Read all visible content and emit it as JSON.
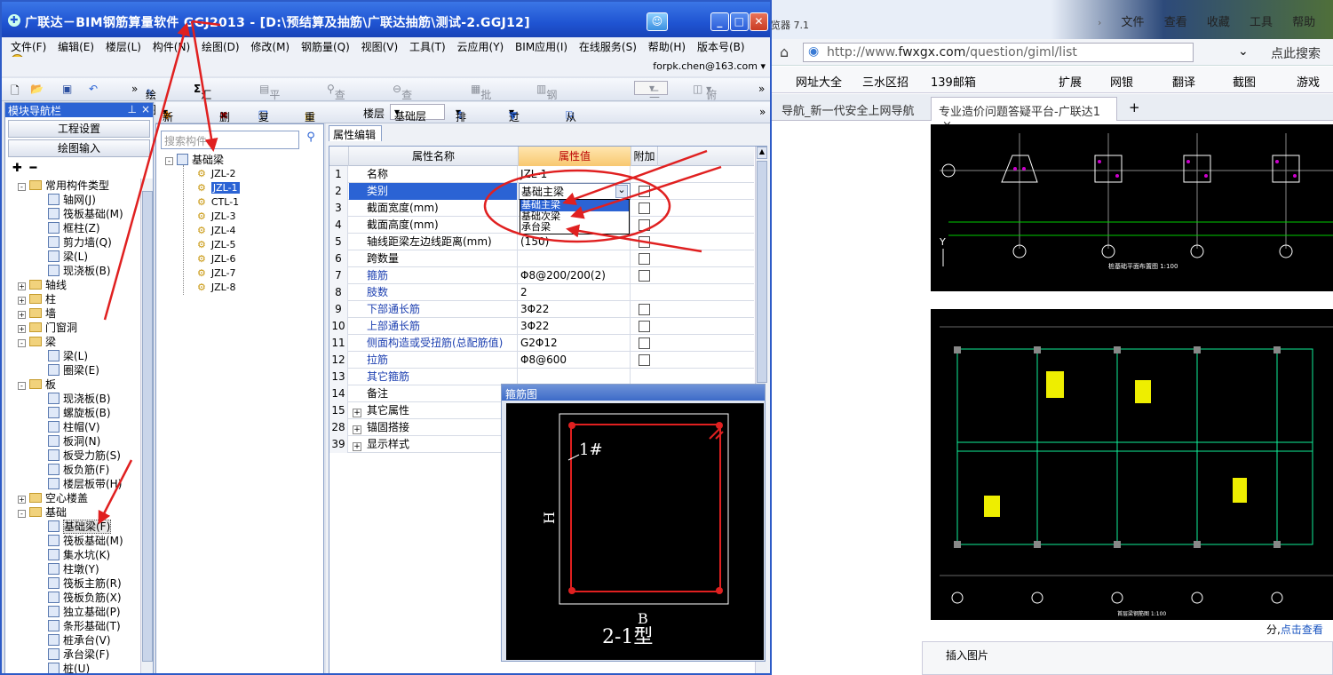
{
  "browser": {
    "title_partial": "览器 7.1",
    "menu": [
      "文件",
      "查看",
      "收藏",
      "工具",
      "帮助"
    ],
    "url_prefix": "http://www.",
    "url_domain": "fwxgx.com",
    "url_path": "/question/giml/list",
    "search_placeholder": "点此搜索",
    "favorites": [
      "网址大全",
      "三水区招",
      "139邮箱",
      "扩展",
      "网银",
      "翻译",
      "截图",
      "游戏"
    ],
    "tabs": [
      "导航_新一代安全上网导航",
      "专业造价问题答疑平台-广联达1"
    ],
    "cad1_caption": "桩基础平面布置图 1:100",
    "cad2_caption": "首层梁钢筋图 1:100",
    "footer_text": "分,",
    "footer_link": "点击查看",
    "insert_image": "插入图片"
  },
  "app": {
    "title": "广联达－BIM钢筋算量软件 GGJ2013 - [D:\\预结算及抽筋\\广联达抽筋\\测试-2.GGJ12]",
    "menu": [
      "文件(F)",
      "编辑(E)",
      "楼层(L)",
      "构件(N)",
      "绘图(D)",
      "修改(M)",
      "钢筋量(Q)",
      "视图(V)",
      "工具(T)",
      "云应用(Y)",
      "BIM应用(I)",
      "在线服务(S)",
      "帮助(H)",
      "版本号(B)"
    ],
    "account": "forpk.chen@163.com ▾",
    "toolbar1": {
      "draw": "绘图",
      "sum": "汇总计算",
      "flat": "平齐板顶",
      "find": "查找图元",
      "view_rebar": "查看钢筋量",
      "batch": "批量选择",
      "rebar3d": "钢筋三维",
      "mode": "二维",
      "view": "俯视"
    },
    "nav": {
      "header": "模块导航栏",
      "project_settings": "工程设置",
      "drawing_input": "绘图输入"
    },
    "nav_tree": [
      {
        "label": "常用构件类型",
        "level": 0,
        "type": "folder",
        "exp": "-"
      },
      {
        "label": "轴网(J)",
        "level": 1,
        "type": "item"
      },
      {
        "label": "筏板基础(M)",
        "level": 1,
        "type": "item"
      },
      {
        "label": "框柱(Z)",
        "level": 1,
        "type": "item"
      },
      {
        "label": "剪力墙(Q)",
        "level": 1,
        "type": "item"
      },
      {
        "label": "梁(L)",
        "level": 1,
        "type": "item"
      },
      {
        "label": "现浇板(B)",
        "level": 1,
        "type": "item"
      },
      {
        "label": "轴线",
        "level": 0,
        "type": "folder",
        "exp": "+"
      },
      {
        "label": "柱",
        "level": 0,
        "type": "folder",
        "exp": "+"
      },
      {
        "label": "墙",
        "level": 0,
        "type": "folder",
        "exp": "+"
      },
      {
        "label": "门窗洞",
        "level": 0,
        "type": "folder",
        "exp": "+"
      },
      {
        "label": "梁",
        "level": 0,
        "type": "folder",
        "exp": "-"
      },
      {
        "label": "梁(L)",
        "level": 1,
        "type": "item"
      },
      {
        "label": "圈梁(E)",
        "level": 1,
        "type": "item"
      },
      {
        "label": "板",
        "level": 0,
        "type": "folder",
        "exp": "-"
      },
      {
        "label": "现浇板(B)",
        "level": 1,
        "type": "item"
      },
      {
        "label": "螺旋板(B)",
        "level": 1,
        "type": "item"
      },
      {
        "label": "柱帽(V)",
        "level": 1,
        "type": "item"
      },
      {
        "label": "板洞(N)",
        "level": 1,
        "type": "item"
      },
      {
        "label": "板受力筋(S)",
        "level": 1,
        "type": "item"
      },
      {
        "label": "板负筋(F)",
        "level": 1,
        "type": "item"
      },
      {
        "label": "楼层板带(H)",
        "level": 1,
        "type": "item"
      },
      {
        "label": "空心楼盖",
        "level": 0,
        "type": "folder",
        "exp": "+"
      },
      {
        "label": "基础",
        "level": 0,
        "type": "folder",
        "exp": "-"
      },
      {
        "label": "基础梁(F)",
        "level": 1,
        "type": "item",
        "selected": true
      },
      {
        "label": "筏板基础(M)",
        "level": 1,
        "type": "item"
      },
      {
        "label": "集水坑(K)",
        "level": 1,
        "type": "item"
      },
      {
        "label": "柱墩(Y)",
        "level": 1,
        "type": "item"
      },
      {
        "label": "筏板主筋(R)",
        "level": 1,
        "type": "item"
      },
      {
        "label": "筏板负筋(X)",
        "level": 1,
        "type": "item"
      },
      {
        "label": "独立基础(P)",
        "level": 1,
        "type": "item"
      },
      {
        "label": "条形基础(T)",
        "level": 1,
        "type": "item"
      },
      {
        "label": "桩承台(V)",
        "level": 1,
        "type": "item"
      },
      {
        "label": "承台梁(F)",
        "level": 1,
        "type": "item"
      },
      {
        "label": "桩(U)",
        "level": 1,
        "type": "item"
      }
    ],
    "toolbar2": {
      "new": "新建",
      "delete": "删除",
      "copy": "复制",
      "rename": "重命名",
      "floor_label": "楼层",
      "floor_value": "基础层",
      "sort": "排序",
      "filter": "过滤",
      "copy_from": "从其他楼层复制构件"
    },
    "search_placeholder": "搜索构件...",
    "comp_root": "基础梁",
    "components": [
      "JZL-2",
      "JZL-1",
      "CTL-1",
      "JZL-3",
      "JZL-4",
      "JZL-5",
      "JZL-6",
      "JZL-7",
      "JZL-8"
    ],
    "selected_component": "JZL-1",
    "prop_tab": "属性编辑",
    "prop_headers": {
      "name": "属性名称",
      "value": "属性值",
      "extra": "附加"
    },
    "props": [
      {
        "n": "1",
        "k": "名称",
        "v": "JZL-1",
        "blue": false,
        "cb": false
      },
      {
        "n": "2",
        "k": "类别",
        "v": "基础主梁",
        "blue": false,
        "cb": true,
        "editing": true
      },
      {
        "n": "3",
        "k": "截面宽度(mm)",
        "v": "",
        "blue": false,
        "cb": true
      },
      {
        "n": "4",
        "k": "截面高度(mm)",
        "v": "",
        "blue": false,
        "cb": true
      },
      {
        "n": "5",
        "k": "轴线距梁左边线距离(mm)",
        "v": "(150)",
        "blue": false,
        "cb": true
      },
      {
        "n": "6",
        "k": "跨数量",
        "v": "",
        "blue": false,
        "cb": true
      },
      {
        "n": "7",
        "k": "箍筋",
        "v": "Φ8@200/200(2)",
        "blue": true,
        "cb": true
      },
      {
        "n": "8",
        "k": "肢数",
        "v": "2",
        "blue": true,
        "cb": false
      },
      {
        "n": "9",
        "k": "下部通长筋",
        "v": "3Φ22",
        "blue": true,
        "cb": true
      },
      {
        "n": "10",
        "k": "上部通长筋",
        "v": "3Φ22",
        "blue": true,
        "cb": true
      },
      {
        "n": "11",
        "k": "侧面构造或受扭筋(总配筋值)",
        "v": "G2Φ12",
        "blue": true,
        "cb": true
      },
      {
        "n": "12",
        "k": "拉筋",
        "v": "Φ8@600",
        "blue": true,
        "cb": true
      },
      {
        "n": "13",
        "k": "其它箍筋",
        "v": "",
        "blue": true,
        "cb": false
      },
      {
        "n": "14",
        "k": "备注",
        "v": "",
        "blue": false,
        "cb": false
      },
      {
        "n": "15",
        "k": "其它属性",
        "v": "",
        "blue": false,
        "cb": false,
        "group": true
      },
      {
        "n": "28",
        "k": "锚固搭接",
        "v": "",
        "blue": false,
        "cb": false,
        "group": true
      },
      {
        "n": "39",
        "k": "显示样式",
        "v": "",
        "blue": false,
        "cb": false,
        "group": true
      }
    ],
    "dropdown": [
      "基础主梁",
      "基础次梁",
      "承台梁"
    ],
    "stirrup": {
      "title": "箍筋图",
      "label_1": "1#",
      "label_h": "H",
      "label_b": "B",
      "type": "2-1型"
    }
  }
}
